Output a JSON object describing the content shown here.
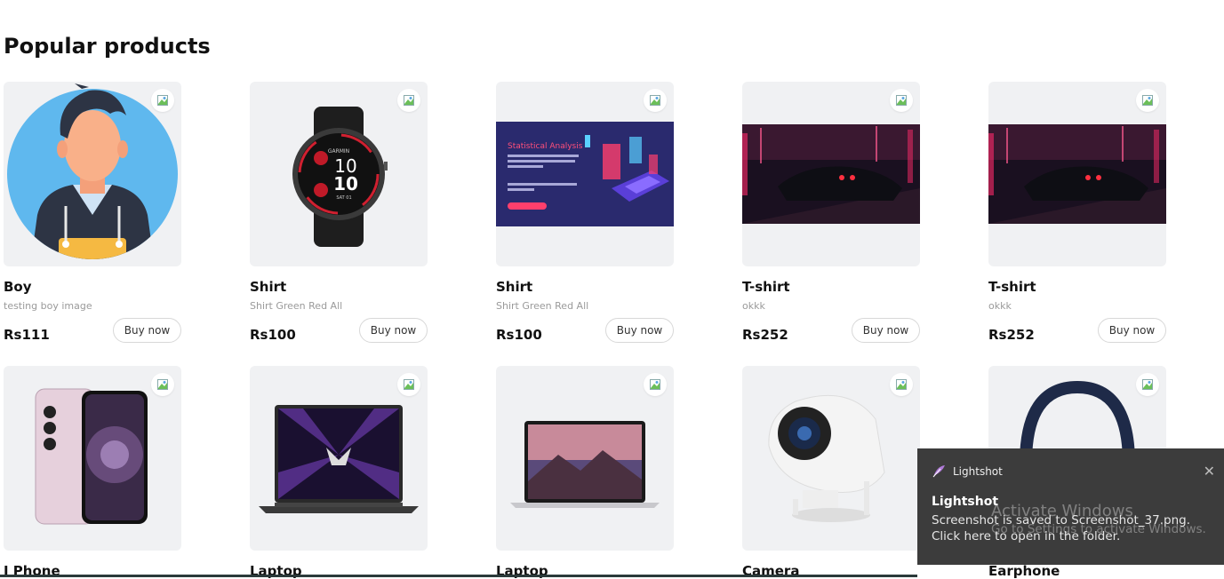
{
  "page": {
    "heading": "Popular products"
  },
  "products": [
    {
      "name": "Boy",
      "desc": "testing boy image",
      "price": "Rs111",
      "buy": "Buy now",
      "image": "avatar-illustration"
    },
    {
      "name": "Shirt",
      "desc": "Shirt Green Red All",
      "price": "Rs100",
      "buy": "Buy now",
      "image": "smartwatch"
    },
    {
      "name": "Shirt",
      "desc": "Shirt Green Red All",
      "price": "Rs100",
      "buy": "Buy now",
      "image": "statistical-analysis-banner",
      "banner_title": "Statistical Analysis"
    },
    {
      "name": "T-shirt",
      "desc": "okkk",
      "price": "Rs252",
      "buy": "Buy now",
      "image": "neon-car"
    },
    {
      "name": "T-shirt",
      "desc": "okkk",
      "price": "Rs252",
      "buy": "Buy now",
      "image": "neon-car"
    },
    {
      "name": "I Phone",
      "image": "smartphone"
    },
    {
      "name": "Laptop",
      "image": "gaming-laptop"
    },
    {
      "name": "Laptop",
      "image": "macbook"
    },
    {
      "name": "Camera",
      "image": "projector"
    },
    {
      "name": "Earphone",
      "image": "headphones"
    }
  ],
  "watch": {
    "brand": "GARMIN",
    "time_h": "10",
    "time_m": "10",
    "date": "SAT 01"
  },
  "toast": {
    "app": "Lightshot",
    "title": "Lightshot",
    "message": "Screenshot is saved to Screenshot_37.png. Click here to open in the folder.",
    "close": "✕"
  },
  "watermark": {
    "line1": "Activate Windows",
    "line2": "Go to Settings to activate Windows."
  },
  "colors": {
    "card_bg": "#f0f1f3",
    "toast_bg": "#3c3c3c"
  }
}
